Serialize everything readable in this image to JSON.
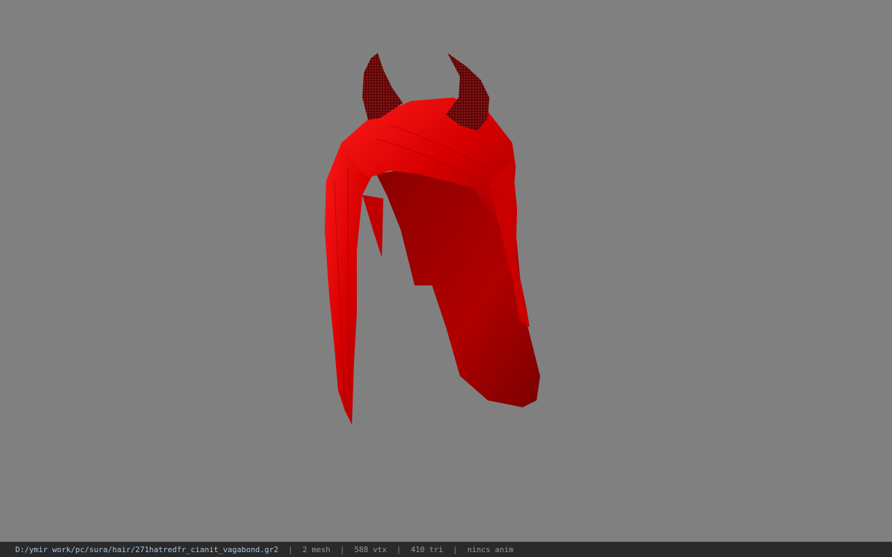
{
  "viewer": {
    "background_color": "#808080",
    "model": {
      "subject": "red horned hair mesh",
      "hair_color": "#e00000",
      "horn_color": "#7a1010"
    }
  },
  "status_bar": {
    "file_path": "D:/ymir work/pc/sura/hair/271hatredfr_cianit_vagabond.gr2",
    "separator": "|",
    "mesh": "2 mesh",
    "vtx": "588 vtx",
    "tri": "410 tri",
    "anim": "nincs anim"
  }
}
